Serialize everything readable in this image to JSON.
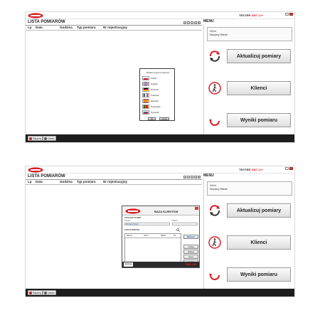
{
  "app": {
    "tester_label": "TESTER",
    "tester_brand": "DBT-12+"
  },
  "list": {
    "title": "LISTA POMIARÓW",
    "columns": [
      "Lp",
      "Data",
      "Godzina",
      "Typ pomiaru",
      "Nr rejestracyjny"
    ]
  },
  "menu": {
    "title": "MENU",
    "client_label": "Klient",
    "client_value": "Wszyscy Klienci",
    "update_label": "Aktualizuj pomiary",
    "clients_label": "Klienci",
    "results_label": "Wyniki pomiaru"
  },
  "bottombar": {
    "btn1": "Raporty",
    "btn2": "Ustaw"
  },
  "language_dialog": {
    "title": "Wybierz język programu",
    "languages": [
      "Polski",
      "English",
      "Deutsch",
      "Français",
      "Español",
      "Português",
      "Русский"
    ],
    "ok_label": "OK",
    "cancel_label": "Anuluj"
  },
  "client_dialog": {
    "title": "BAZA KLIENTÓW",
    "section_current": "AKTUALNY KLIENT",
    "section_list": "LISTA KLIENTÓW",
    "field_name": "Nazwa",
    "field_city": "Miasto",
    "current_value": "Wszyscy Klienci",
    "table_columns": [
      "Nazwa",
      "Adres",
      "Miasto",
      "Tel"
    ],
    "btn_select": "Wybierz",
    "btn_add": "Dodaj",
    "btn_edit": "Edytuj",
    "btn_delete": "Usuń",
    "btn_import": "Import",
    "close_label": "Zamknij",
    "brand": "DBT-12+"
  },
  "colors": {
    "accent": "#d81f26",
    "dark_bar": "#1d1d1d"
  }
}
